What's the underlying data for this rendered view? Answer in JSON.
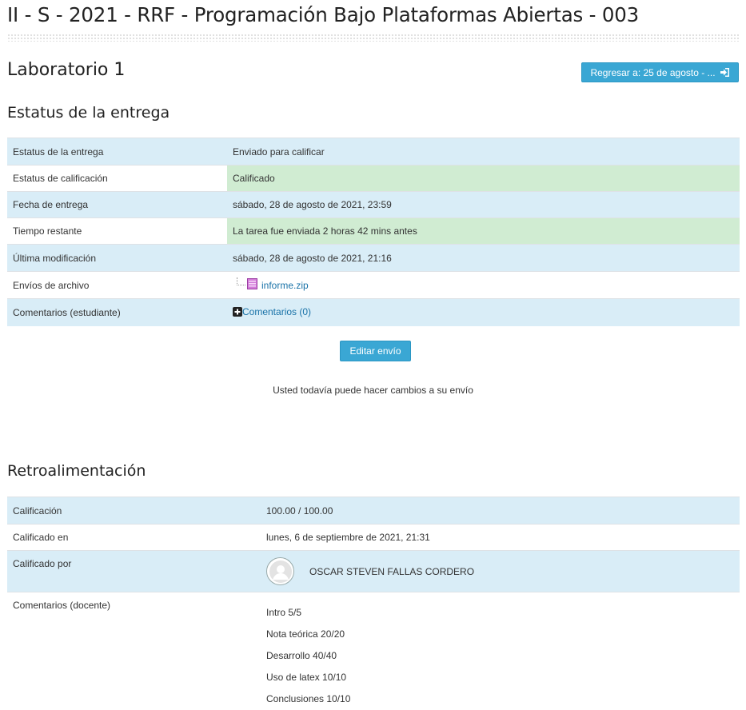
{
  "course": {
    "title": "II - S - 2021 - RRF - Programación Bajo Plataformas Abiertas - 003"
  },
  "assignment": {
    "title": "Laboratorio 1",
    "return_button": "Regresar a: 25 de agosto - ..."
  },
  "submission": {
    "heading": "Estatus de la entrega",
    "rows": [
      {
        "label": "Estatus de la entrega",
        "value": "Enviado para calificar"
      },
      {
        "label": "Estatus de calificación",
        "value": "Calificado"
      },
      {
        "label": "Fecha de entrega",
        "value": "sábado, 28 de agosto de 2021, 23:59"
      },
      {
        "label": "Tiempo restante",
        "value": "La tarea fue enviada 2 horas 42 mins antes"
      },
      {
        "label": "Última modificación",
        "value": "sábado, 28 de agosto de 2021, 21:16"
      },
      {
        "label": "Envíos de archivo",
        "value": "informe.zip"
      },
      {
        "label": "Comentarios (estudiante)",
        "value": "Comentarios (0)"
      }
    ],
    "edit_button": "Editar envío",
    "edit_note": "Usted todavía puede hacer cambios a su envío"
  },
  "feedback": {
    "heading": "Retroalimentación",
    "rows": [
      {
        "label": "Calificación",
        "value": "100.00 / 100.00"
      },
      {
        "label": "Calificado en",
        "value": "lunes, 6 de septiembre de 2021, 21:31"
      },
      {
        "label": "Calificado por",
        "value": "OSCAR STEVEN FALLAS CORDERO"
      },
      {
        "label": "Comentarios (docente)"
      }
    ],
    "comments": [
      "Intro 5/5",
      "Nota teórica 20/20",
      "Desarrollo 40/40",
      "Uso de latex 10/10",
      "Conclusiones 10/10"
    ]
  },
  "icons": {
    "return_icon": "sign-in-icon",
    "file_icon": "archive-file-icon",
    "comments_icon": "plus-square-icon",
    "avatar_icon": "user-avatar-icon"
  },
  "colors": {
    "accent": "#3aa7d4",
    "row_highlight": "#d9edf7",
    "success": "#d0ecd2",
    "link": "#1a73a8"
  }
}
